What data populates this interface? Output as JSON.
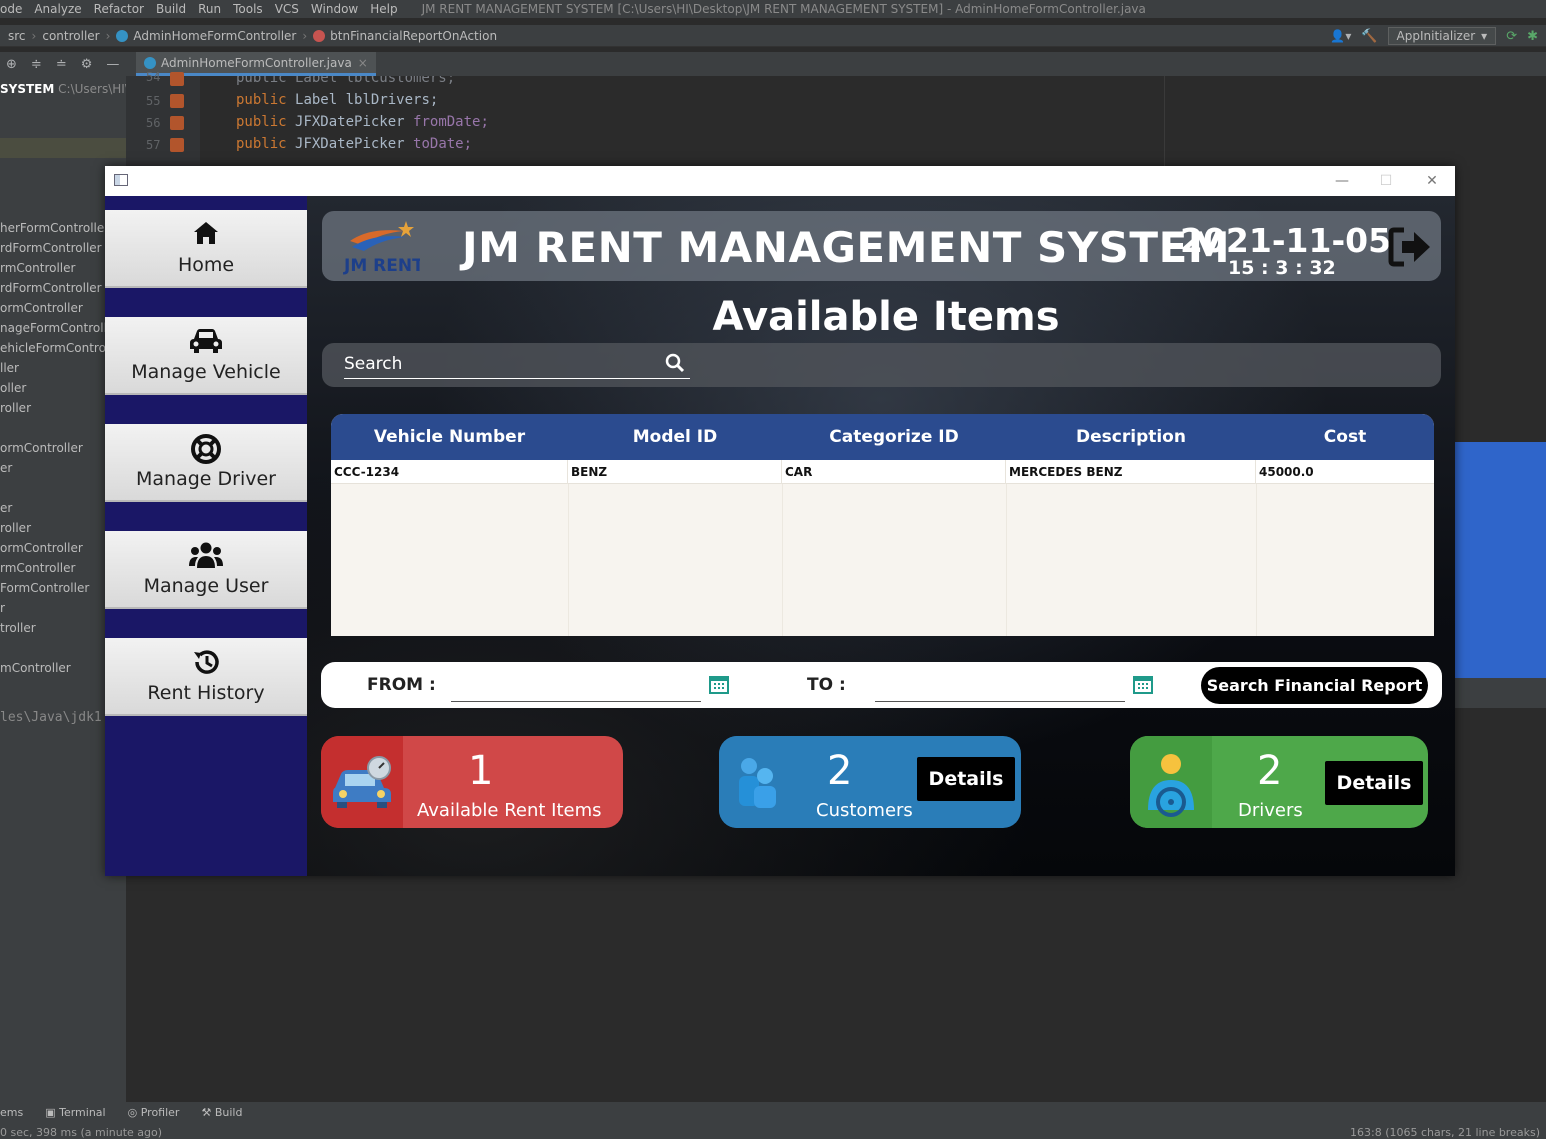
{
  "ide": {
    "menu": [
      "ode",
      "Analyze",
      "Refactor",
      "Build",
      "Run",
      "Tools",
      "VCS",
      "Window",
      "Help"
    ],
    "window_title": "JM RENT MANAGEMENT SYSTEM [C:\\Users\\HI\\Desktop\\JM RENT MANAGEMENT SYSTEM] - AdminHomeFormController.java",
    "breadcrumbs": [
      "src",
      "controller",
      "AdminHomeFormController",
      "btnFinancialReportOnAction"
    ],
    "run_config": "AppInitializer",
    "editor_tab": "AdminHomeFormController.java",
    "project_root_name": "SYSTEM",
    "project_root_path": "C:\\Users\\HI\\De",
    "tree_items": [
      "herFormController",
      "rdFormController",
      "rmController",
      "rdFormController",
      "ormController",
      "nageFormController",
      "ehicleFormControlle",
      "ller",
      "oller",
      "roller",
      "ormController",
      "er",
      "er",
      "roller",
      "ormController",
      "rmController",
      "FormController",
      "r",
      "troller",
      "mController"
    ],
    "code_lines": [
      {
        "num": "54",
        "code": "public Label lblCustomers;"
      },
      {
        "num": "55",
        "kw": "public",
        "type": "Label",
        "field": "lblDrivers;"
      },
      {
        "num": "56",
        "kw": "public",
        "type": "JFXDatePicker",
        "field": "fromDate;"
      },
      {
        "num": "57",
        "kw": "public",
        "type": "JFXDatePicker",
        "field": "toDate;"
      }
    ],
    "console_text": "les\\Java\\jdk1",
    "bottom_tools": [
      "ems",
      "Terminal",
      "Profiler",
      "Build"
    ],
    "status_message": "0 sec, 398 ms (a minute ago)",
    "cursor_position": "163:8 (1065 chars, 21 line breaks)"
  },
  "app": {
    "title": "JM RENT MANAGEMENT SYSTEM",
    "logo_text": "JM RENT",
    "date": "2021-11-05",
    "time": "15 : 3 : 32",
    "page_heading": "Available Items",
    "nav": [
      {
        "label": "Home",
        "icon": "home-icon"
      },
      {
        "label": "Manage Vehicle",
        "icon": "car-icon"
      },
      {
        "label": "Manage Driver",
        "icon": "lifebuoy-icon"
      },
      {
        "label": "Manage User",
        "icon": "users-icon"
      },
      {
        "label": "Rent History",
        "icon": "history-icon"
      }
    ],
    "search": {
      "placeholder": "Search"
    },
    "table": {
      "columns": [
        "Vehicle Number",
        "Model ID",
        "Categorize ID",
        "Description",
        "Cost"
      ],
      "rows": [
        [
          "CCC-1234",
          "BENZ",
          "CAR",
          "MERCEDES BENZ",
          "45000.0"
        ]
      ]
    },
    "report": {
      "from_label": "FROM :",
      "to_label": "TO :",
      "button_label": "Search Financial Report"
    },
    "cards": [
      {
        "value": "1",
        "label": "Available Rent Items",
        "color": "#d04848"
      },
      {
        "value": "2",
        "label": "Customers",
        "details": "Details",
        "color": "#2a7db8"
      },
      {
        "value": "2",
        "label": "Drivers",
        "details": "Details",
        "color": "#4ea84a"
      }
    ],
    "colors": {
      "sidebar": "#1a1766",
      "table_header": "#2b4b8f",
      "accent_blue": "#2f65ca"
    }
  }
}
